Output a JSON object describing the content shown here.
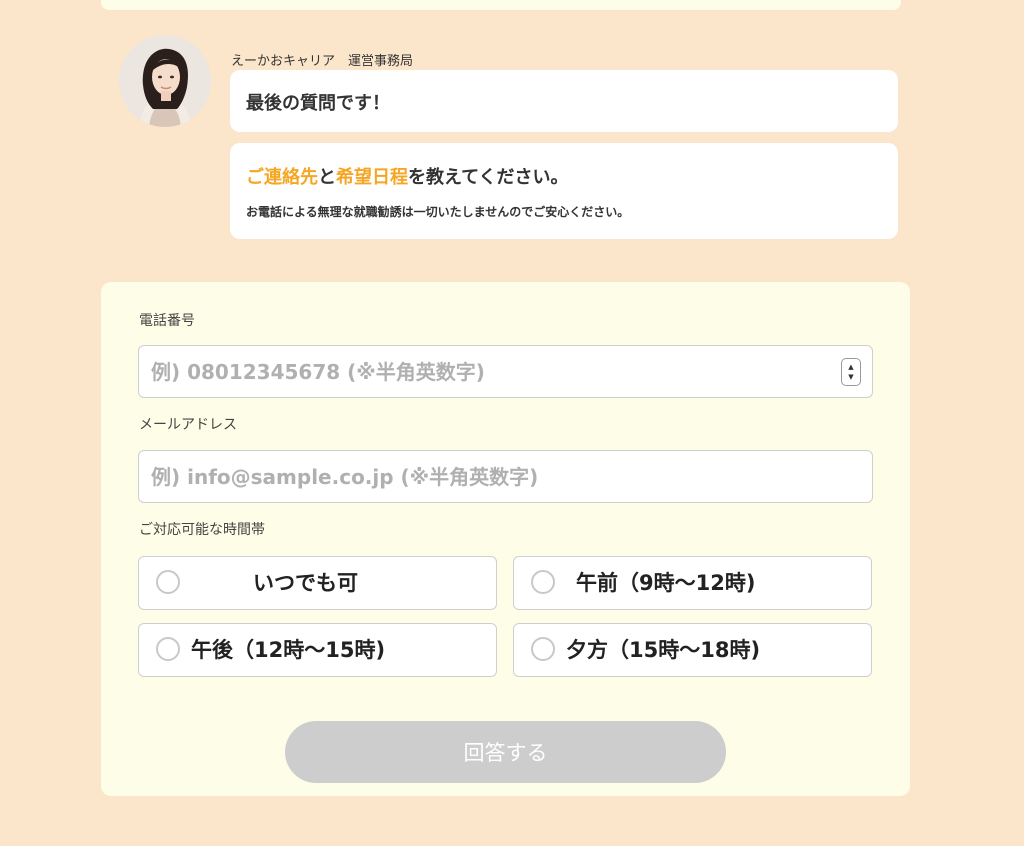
{
  "chat": {
    "sender_name": "えーかおキャリア　運営事務局",
    "message1": "最後の質問です！",
    "message2": {
      "part1": "ご連絡先",
      "part2": "と",
      "part3": "希望日程",
      "part4": "を教えてください。",
      "note": "お電話による無理な就職勧誘は一切いたしませんのでご安心ください。"
    },
    "highlight_color": "#f5a623"
  },
  "form": {
    "phone": {
      "label": "電話番号",
      "placeholder": "例) 08012345678 (※半角英数字)",
      "value": ""
    },
    "email": {
      "label": "メールアドレス",
      "placeholder": "例) info@sample.co.jp (※半角英数字)",
      "value": ""
    },
    "time": {
      "label": "ご対応可能な時間帯",
      "options": [
        "いつでも可",
        "午前（9時〜12時)",
        "午後（12時〜15時)",
        "夕方（15時〜18時)"
      ]
    },
    "submit_label": "回答する"
  },
  "colors": {
    "page_background": "#fbe6cb",
    "form_background": "#fefee8",
    "submit_disabled": "#cdcdcd"
  }
}
